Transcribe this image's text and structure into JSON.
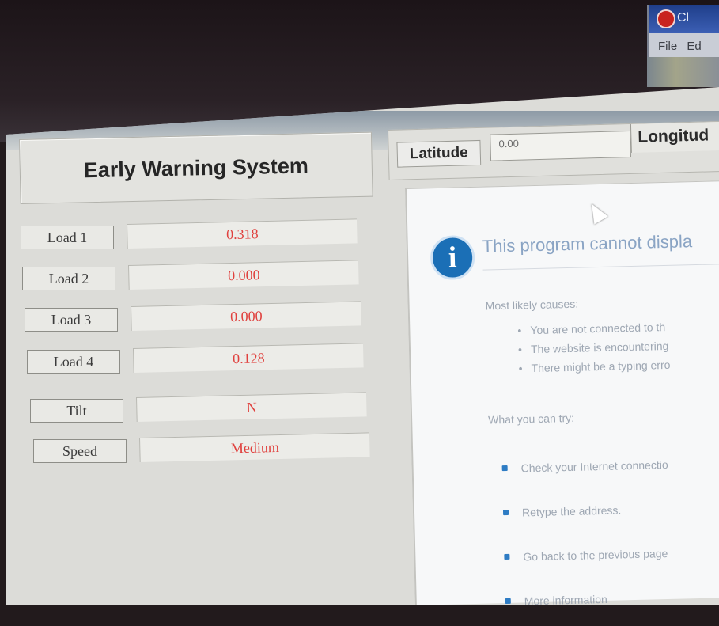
{
  "corner_app": {
    "title_fragment": "Cl",
    "menu": [
      "File",
      "Ed"
    ]
  },
  "app": {
    "title": "Early Warning System",
    "latitude_label": "Latitude",
    "latitude_value": "0.00",
    "longitude_label": "Longitud"
  },
  "readings": [
    {
      "label": "Load 1",
      "value": "0.318"
    },
    {
      "label": "Load 2",
      "value": "0.000"
    },
    {
      "label": "Load 3",
      "value": "0.000"
    },
    {
      "label": "Load 4",
      "value": "0.128"
    },
    {
      "label": "Tilt",
      "value": "N"
    },
    {
      "label": "Speed",
      "value": "Medium"
    }
  ],
  "browser_error": {
    "title": "This program cannot displa",
    "causes_heading": "Most likely causes:",
    "causes": [
      "You are not connected to th",
      "The website is encountering",
      "There might be a typing erro"
    ],
    "try_heading": "What you can try:",
    "tries": [
      "Check your Internet connectio",
      "Retype the address.",
      "Go back to the previous page",
      "More information"
    ]
  },
  "colors": {
    "value_text": "#e0413e",
    "info_icon": "#1b6fb6",
    "bullet": "#2e7cc4"
  }
}
